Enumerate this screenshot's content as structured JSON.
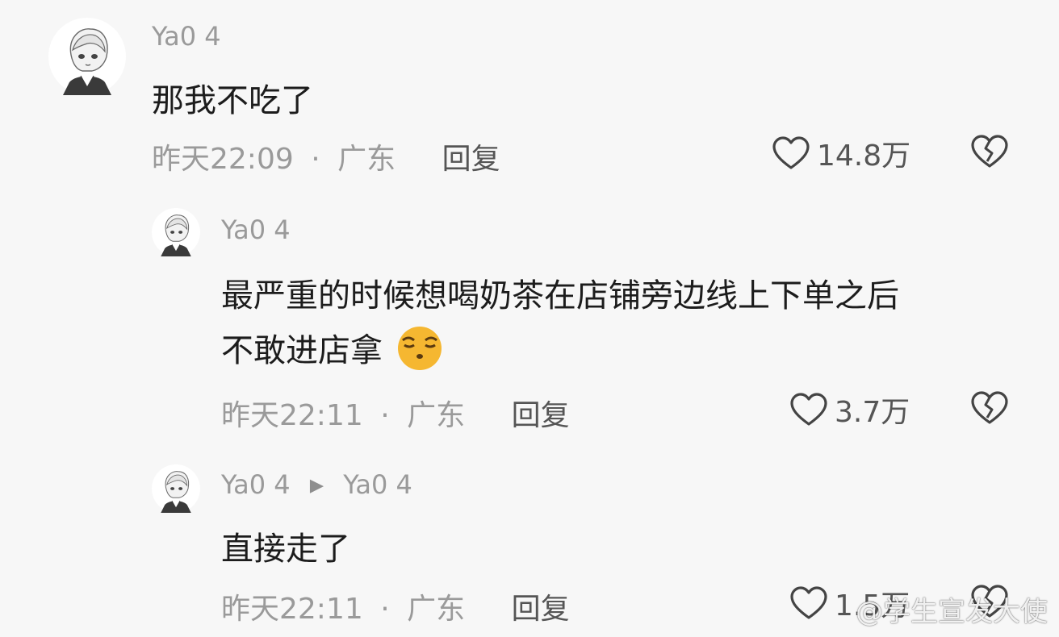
{
  "comments": [
    {
      "username": "Ya0 4",
      "text": "那我不吃了",
      "time": "昨天22:09",
      "location": "广东",
      "reply_label": "回复",
      "likes": "14.8万",
      "avatar_icon": "anime-boy-avatar-icon"
    },
    {
      "username": "Ya0 4",
      "text_line1": "最严重的时候想喝奶茶在店铺旁边线上下单之后",
      "text_line2": "不敢进店拿",
      "emoji_icon": "sleepy-face-emoji-icon",
      "time": "昨天22:11",
      "location": "广东",
      "reply_label": "回复",
      "likes": "3.7万",
      "avatar_icon": "anime-boy-avatar-icon"
    },
    {
      "username": "Ya0 4",
      "reply_to": "Ya0 4",
      "text": "直接走了",
      "time": "昨天22:11",
      "location": "广东",
      "reply_label": "回复",
      "likes": "1.5万",
      "avatar_icon": "anime-boy-avatar-icon"
    }
  ],
  "separator": "·",
  "reply_arrow": "▶",
  "watermark": "@学生宣发大使",
  "colors": {
    "background": "#f7f7f7",
    "text": "#1c1c1c",
    "muted": "#9a9a9a",
    "action": "#555555"
  }
}
